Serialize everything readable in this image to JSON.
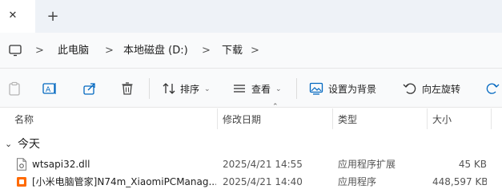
{
  "tabbar": {
    "close_glyph": "✕",
    "add_glyph": "+"
  },
  "address": {
    "segments": [
      "此电脑",
      "本地磁盘 (D:)",
      "下载"
    ],
    "separator": ">"
  },
  "toolbar": {
    "sort_label": "排序",
    "view_label": "查看",
    "wallpaper_label": "设置为背景",
    "rotate_label": "向左旋转",
    "caret": "⌄"
  },
  "columns": {
    "name": "名称",
    "date": "修改日期",
    "type": "类型",
    "size": "大小",
    "sort_caret": "⌃"
  },
  "group": {
    "label": "今天",
    "chevron": "⌄"
  },
  "files": [
    {
      "name": "wtsapi32.dll",
      "date": "2025/4/21 14:55",
      "type": "应用程序扩展",
      "size": "45 KB"
    },
    {
      "name": "[小米电脑管家]N74m_XiaomiPCManag...",
      "date": "2025/4/21 14:40",
      "type": "应用程序",
      "size": "448,597 KB"
    }
  ],
  "colors": {
    "accent": "#0067c0",
    "tabbar_bg": "#eef2f7",
    "toolbar_bg": "#f9fafb"
  }
}
